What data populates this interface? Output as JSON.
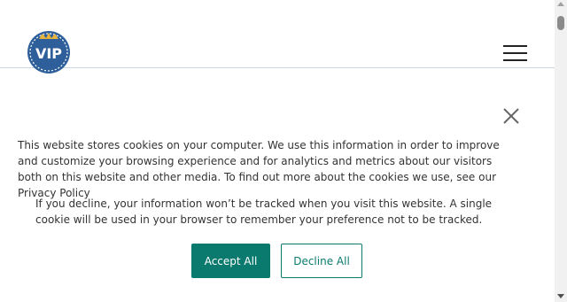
{
  "header": {
    "logo_text": "VIP",
    "logo_icon": "vip-badge-logo",
    "menu_icon": "hamburger-icon"
  },
  "cookie_banner": {
    "close_icon": "close-icon",
    "message": "This website stores cookies on your computer. We use this information in order to improve and customize your browsing experience and for analytics and metrics about our visitors both on this website and other media. To find out more about the cookies we use, see our Privacy Policy",
    "decline_info": "If you decline, your information won’t be tracked when you visit this website. A single cookie will be used in your browser to remember your preference not to be tracked.",
    "accept_label": "Accept All",
    "decline_label": "Decline All"
  },
  "colors": {
    "accent": "#0b7a6e",
    "logo_blue": "#2f5f9a",
    "text": "#333333"
  }
}
